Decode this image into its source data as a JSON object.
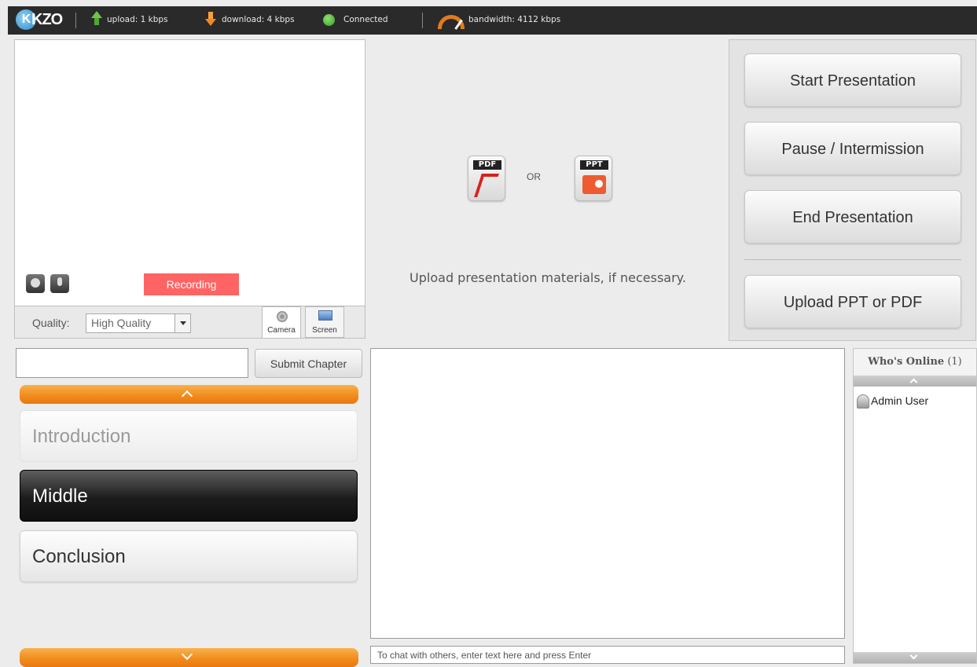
{
  "topbar": {
    "logo": "KZO",
    "upload": "upload: 1 kbps",
    "download": "download: 4 kbps",
    "connection": "Connected",
    "bandwidth": "bandwidth: 4112 kbps"
  },
  "video": {
    "recording_label": "Recording",
    "quality_label": "Quality:",
    "quality_value": "High Quality",
    "tabs": [
      {
        "label": "Camera",
        "active": true
      },
      {
        "label": "Screen",
        "active": false
      }
    ]
  },
  "presentation": {
    "pdf_label": "PDF",
    "ppt_label": "PPT",
    "or_text": "OR",
    "upload_hint": "Upload presentation materials, if necessary."
  },
  "controls": {
    "start": "Start Presentation",
    "pause": "Pause / Intermission",
    "end": "End Presentation",
    "upload": "Upload PPT or PDF"
  },
  "chapters": {
    "input_value": "",
    "submit_label": "Submit Chapter",
    "items": [
      {
        "label": "Introduction",
        "state": "disabled"
      },
      {
        "label": "Middle",
        "state": "active"
      },
      {
        "label": "Conclusion",
        "state": "normal"
      }
    ]
  },
  "chat": {
    "input_placeholder": "To chat with others, enter text here and press Enter"
  },
  "online": {
    "title": "Who's Online",
    "count": "(1)",
    "users": [
      "Admin User"
    ]
  },
  "colors": {
    "accent_orange": "#f08a1c",
    "recording_red": "#ff6464",
    "topbar_bg": "#2a2a2a",
    "connected_green": "#3a9a2a"
  }
}
